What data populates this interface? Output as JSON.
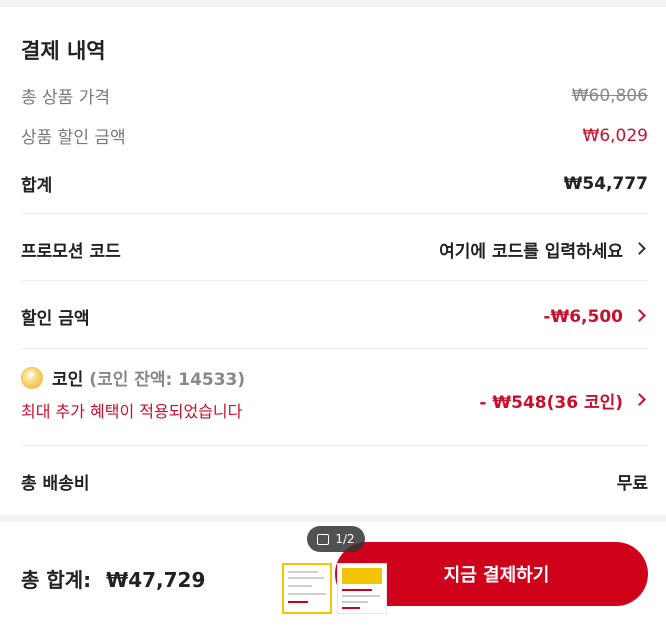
{
  "summary": {
    "title": "결제 내역",
    "total_product_price_label": "총 상품 가격",
    "total_product_price_value": "₩60,806",
    "product_discount_label": "상품 할인 금액",
    "product_discount_value": "₩6,029",
    "subtotal_label": "합계",
    "subtotal_value": "₩54,777",
    "promo_label": "프로모션 코드",
    "promo_action": "여기에 코드를 입력하세요",
    "discount_label": "할인 금액",
    "discount_value": "-₩6,500",
    "coin_label": "코인",
    "coin_balance": "(코인 잔액: 14533)",
    "coin_benefit_note": "최대 추가 혜택이 적용되었습니다",
    "coin_value": "- ₩548(36 코인)",
    "shipping_label": "총 배송비",
    "shipping_value": "무료"
  },
  "footer": {
    "total_label": "총 합계:",
    "total_value": "₩47,729",
    "image_counter": "1/2",
    "pay_button_label": "지금 결제하기"
  },
  "colors": {
    "accent_red": "#d0021b",
    "discount_red": "#c8102e",
    "thumb_border": "#f5c400"
  }
}
